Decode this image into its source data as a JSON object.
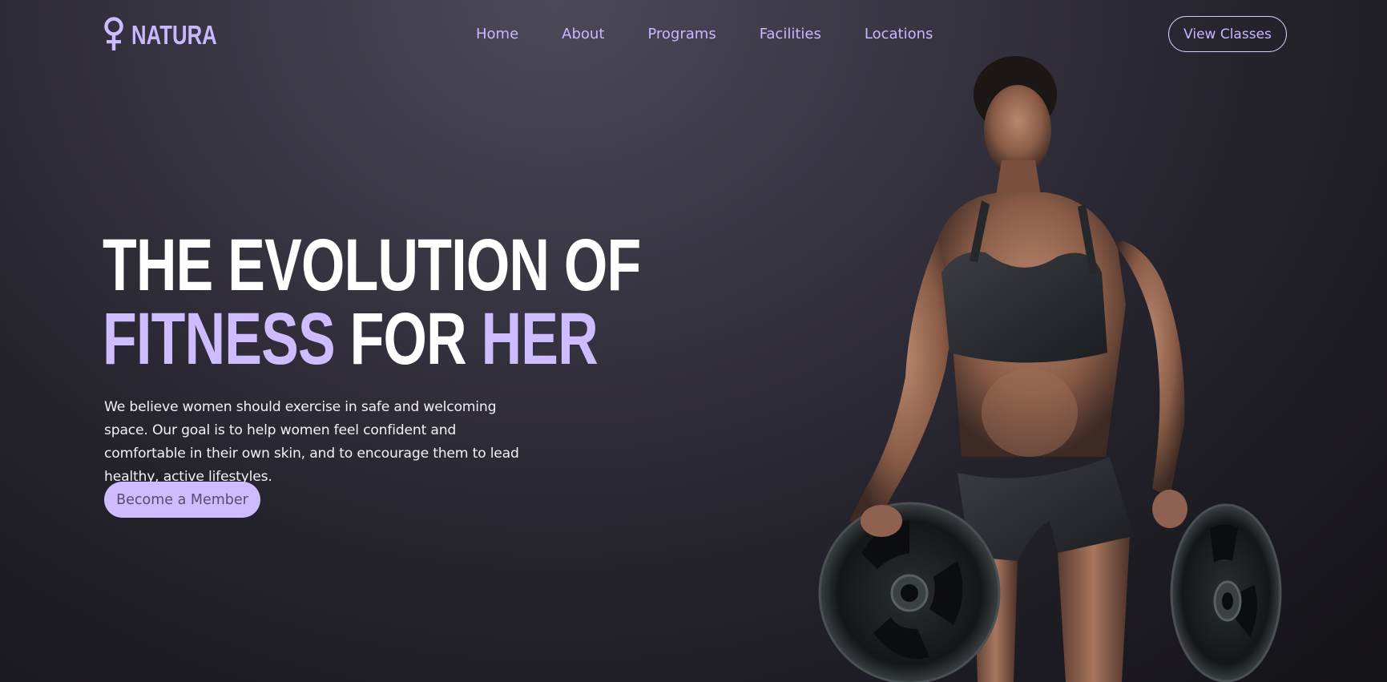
{
  "brand": {
    "name": "NATURA",
    "icon": "female-symbol-icon",
    "accent_color": "#cdbcff"
  },
  "nav": {
    "items": [
      {
        "label": "Home"
      },
      {
        "label": "About"
      },
      {
        "label": "Programs"
      },
      {
        "label": "Facilities"
      },
      {
        "label": "Locations"
      }
    ],
    "cta_label": "View Classes"
  },
  "hero": {
    "title_line1": "THE EVOLUTION OF",
    "title_line2_part1": "FITNESS",
    "title_line2_part2": "FOR",
    "title_line2_part3": "HER",
    "description": "We believe women should exercise in safe and welcoming space. Our goal is to help women feel confident and comfortable in their own skin, and to encourage them to lead healthy, active lifestyles.",
    "cta_label": "Become a  Member"
  }
}
